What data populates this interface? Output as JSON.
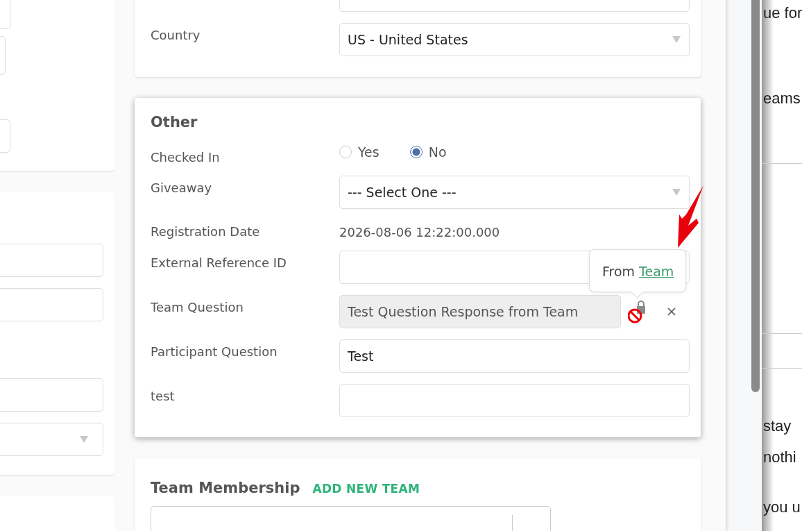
{
  "left_cards": [
    {
      "kind": "fields",
      "fields": [
        {
          "kind": "input"
        },
        {
          "kind": "input"
        },
        {
          "kind": "input"
        }
      ]
    },
    {
      "kind": "fields",
      "fields": [
        {
          "kind": "input"
        },
        {
          "kind": "input"
        },
        {
          "kind": "input"
        },
        {
          "kind": "select"
        }
      ]
    },
    {
      "kind": "blank"
    }
  ],
  "address_card": {
    "fields": [
      {
        "kind": "input"
      },
      {
        "kind": "select",
        "label": "Country",
        "value": "US - United States"
      }
    ]
  },
  "other_card": {
    "title": "Other",
    "fields": [
      {
        "kind": "radio",
        "label": "Checked In",
        "options": [
          {
            "label": "Yes",
            "selected": false
          },
          {
            "label": "No",
            "selected": true
          }
        ]
      },
      {
        "kind": "select",
        "label": "Giveaway",
        "value": "--- Select One ---"
      },
      {
        "kind": "text",
        "label": "Registration Date",
        "value": "2026-08-06 12:22:00.000"
      },
      {
        "kind": "input",
        "label": "External Reference ID"
      },
      {
        "kind": "inherited",
        "label": "Team Question",
        "value": "Test Question Response from Team",
        "disabled": true
      },
      {
        "kind": "input",
        "label": "Participant Question",
        "value": "Test"
      },
      {
        "kind": "input",
        "label": "test"
      }
    ],
    "tooltip": {
      "text": "From",
      "link": "Team"
    }
  },
  "team_card": {
    "title": "Team Membership",
    "action": "ADD NEW TEAM"
  },
  "right_panel": {
    "sections": [
      {
        "kind": "text",
        "lines": [
          "ue for",
          "eams"
        ]
      },
      {
        "kind": "blank"
      },
      {
        "kind": "blank"
      },
      {
        "kind": "note",
        "lines": [
          "stay",
          "nothi",
          "you u"
        ]
      }
    ]
  }
}
